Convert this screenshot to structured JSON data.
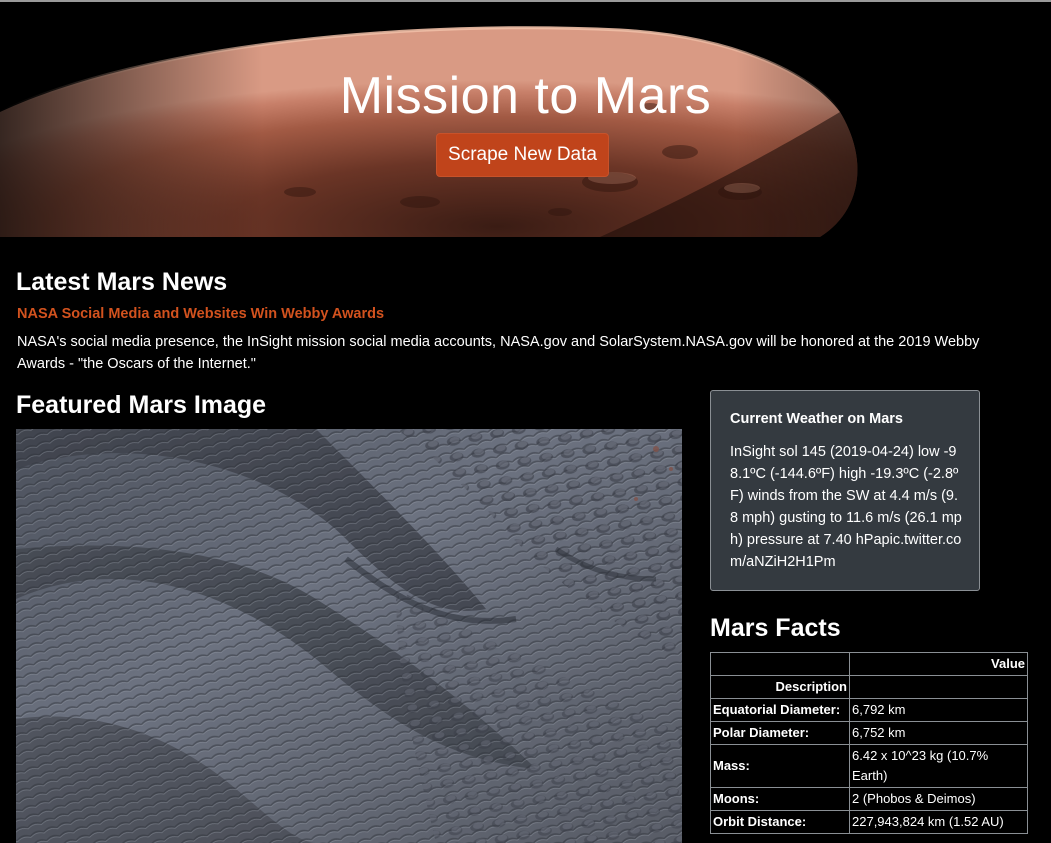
{
  "hero": {
    "title": "Mission to Mars",
    "button_label": "Scrape New Data"
  },
  "news": {
    "heading": "Latest Mars News",
    "title": "NASA Social Media and Websites Win Webby Awards",
    "body": "NASA's social media presence, the InSight mission social media accounts, NASA.gov and SolarSystem.NASA.gov will be honored at the 2019 Webby Awards - \"the Oscars of the Internet.\""
  },
  "featured": {
    "heading": "Featured Mars Image"
  },
  "weather": {
    "title": "Current Weather on Mars",
    "text": "InSight sol 145 (2019-04-24) low -98.1ºC (-144.6ºF) high -19.3ºC (-2.8ºF) winds from the SW at 4.4 m/s (9.8 mph) gusting to 11.6 m/s (26.1 mph) pressure at 7.40 hPapic.twitter.com/aNZiH2H1Pm"
  },
  "facts": {
    "heading": "Mars Facts",
    "value_header": "Value",
    "index_header": "Description",
    "rows": [
      {
        "label": "Equatorial Diameter:",
        "value": "6,792 km"
      },
      {
        "label": "Polar Diameter:",
        "value": "6,752 km"
      },
      {
        "label": "Mass:",
        "value": "6.42 x 10^23 kg (10.7% Earth)"
      },
      {
        "label": "Moons:",
        "value": "2 (Phobos & Deimos)"
      },
      {
        "label": "Orbit Distance:",
        "value": "227,943,824 km (1.52 AU)"
      }
    ]
  },
  "colors": {
    "accent": "#c0441b",
    "news_title": "#d2521e",
    "card_bg": "#343a40"
  }
}
